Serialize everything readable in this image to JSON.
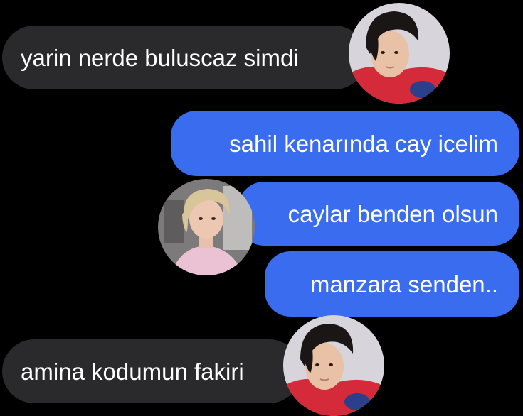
{
  "messages": [
    {
      "direction": "incoming",
      "text": "yarin nerde buluscaz simdi",
      "avatar": "dark-haired-person-red-shirt"
    },
    {
      "direction": "outgoing",
      "text": "sahil kenarında cay icelim"
    },
    {
      "direction": "outgoing",
      "text": "caylar benden olsun",
      "avatar": "blonde-person-pink-shirt"
    },
    {
      "direction": "outgoing",
      "text": "manzara senden.."
    },
    {
      "direction": "incoming",
      "text": "amina kodumun fakiri",
      "avatar": "dark-haired-person-red-shirt"
    }
  ],
  "colors": {
    "background": "#000000",
    "incoming_bubble": "#2a2a2c",
    "outgoing_bubble": "#3a6cf0",
    "text": "#ffffff"
  }
}
